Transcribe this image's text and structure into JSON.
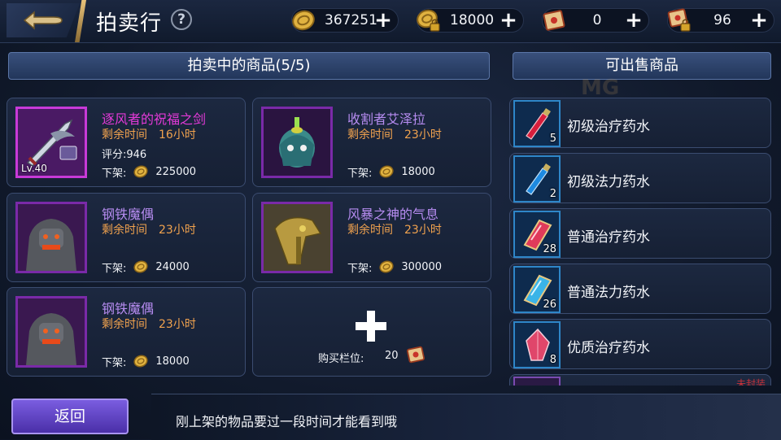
{
  "header": {
    "title": "拍卖行",
    "help_symbol": "?",
    "resources": [
      {
        "icon": "gold-coin-icon",
        "value": "367251",
        "add": "+"
      },
      {
        "icon": "locked-coin-icon",
        "value": "18000",
        "add": "+"
      },
      {
        "icon": "scroll-ticket-icon",
        "value": "0",
        "add": "+"
      },
      {
        "icon": "locked-scroll-icon",
        "value": "96",
        "add": "+"
      }
    ]
  },
  "auction": {
    "heading": "拍卖中的商品(5/5)",
    "time_label": "剩余时间",
    "price_label": "下架:",
    "items": [
      {
        "name": "逐风者的祝福之剑",
        "name_color": "#e43ad8",
        "time": "16小时",
        "score": "评分:946",
        "level": "Lv.40",
        "price": "225000",
        "icon": "sword-icon"
      },
      {
        "name": "收割者艾泽拉",
        "name_color": "#b68cf0",
        "time": "23小时",
        "score": "",
        "level": "",
        "price": "18000",
        "icon": "reaper-pet-icon"
      },
      {
        "name": "钢铁魔偶",
        "name_color": "#b68cf0",
        "time": "23小时",
        "score": "",
        "level": "",
        "price": "24000",
        "icon": "iron-golem-icon"
      },
      {
        "name": "风暴之神的气息",
        "name_color": "#b68cf0",
        "time": "23小时",
        "score": "",
        "level": "",
        "price": "300000",
        "icon": "storm-helmet-icon"
      },
      {
        "name": "钢铁魔偶",
        "name_color": "#b68cf0",
        "time": "23小时",
        "score": "",
        "level": "",
        "price": "18000",
        "icon": "iron-golem-icon"
      }
    ],
    "buy_slot": {
      "label": "购买栏位:",
      "count": "20",
      "plus": "+"
    }
  },
  "sellable": {
    "heading": "可出售商品",
    "items": [
      {
        "name": "初级治疗药水",
        "count": "5",
        "icon": "red-potion-icon",
        "color": "#d81e3c"
      },
      {
        "name": "初级法力药水",
        "count": "2",
        "icon": "blue-potion-icon",
        "color": "#1e8ae0"
      },
      {
        "name": "普通治疗药水",
        "count": "28",
        "icon": "red-crystal-potion-icon",
        "color": "#e03a5a"
      },
      {
        "name": "普通法力药水",
        "count": "26",
        "icon": "blue-crystal-potion-icon",
        "color": "#3ab4e8"
      },
      {
        "name": "优质治疗药水",
        "count": "8",
        "icon": "red-gem-potion-icon",
        "color": "#e0466a"
      },
      {
        "name": "",
        "count": "",
        "icon": "partial-item-icon",
        "color": "#7a4ab0",
        "tag": "未封装"
      }
    ]
  },
  "footer": {
    "back_label": "返回",
    "tip": "刚上架的物品要过一段时间才能看到哦"
  },
  "colors": {
    "time": "#f0a24e",
    "accent": "#7a5de0"
  }
}
